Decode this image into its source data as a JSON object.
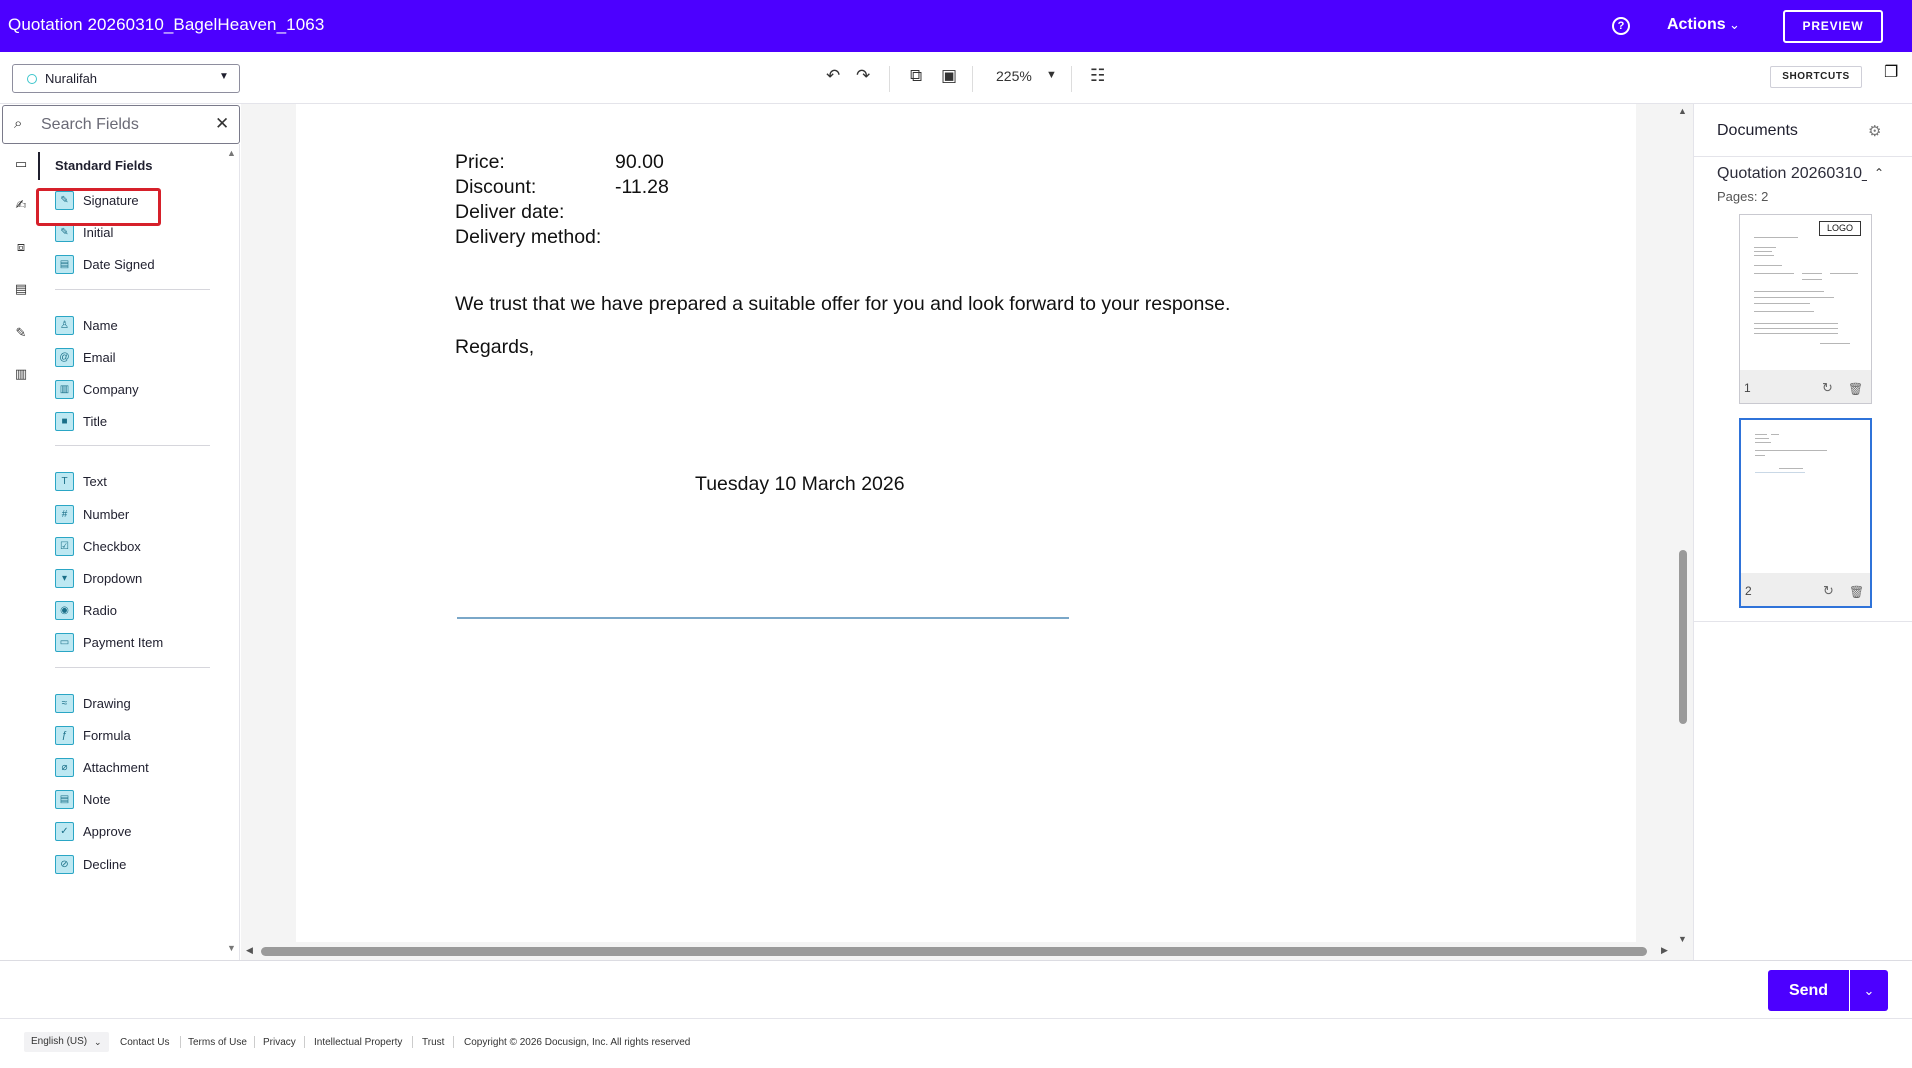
{
  "header": {
    "title": "Quotation 20260310_BagelHeaven_1063",
    "actions_label": "Actions",
    "preview_label": "PREVIEW"
  },
  "toolbar": {
    "recipient": "Nuralifah",
    "zoom": "225%",
    "shortcuts_label": "SHORTCUTS"
  },
  "search": {
    "placeholder": "Search Fields"
  },
  "fields_panel": {
    "heading": "Standard Fields",
    "groups": [
      [
        {
          "label": "Signature",
          "icon": "signature-icon",
          "glyph": "✎"
        },
        {
          "label": "Initial",
          "icon": "initial-icon",
          "glyph": "✎"
        },
        {
          "label": "Date Signed",
          "icon": "date-signed-icon",
          "glyph": "▤"
        }
      ],
      [
        {
          "label": "Name",
          "icon": "name-icon",
          "glyph": "♙"
        },
        {
          "label": "Email",
          "icon": "email-icon",
          "glyph": "@"
        },
        {
          "label": "Company",
          "icon": "company-icon",
          "glyph": "▥"
        },
        {
          "label": "Title",
          "icon": "title-icon",
          "glyph": "■"
        }
      ],
      [
        {
          "label": "Text",
          "icon": "text-icon",
          "glyph": "T"
        },
        {
          "label": "Number",
          "icon": "number-icon",
          "glyph": "#"
        },
        {
          "label": "Checkbox",
          "icon": "checkbox-icon",
          "glyph": "☑"
        },
        {
          "label": "Dropdown",
          "icon": "dropdown-icon",
          "glyph": "▾"
        },
        {
          "label": "Radio",
          "icon": "radio-icon",
          "glyph": "◉"
        },
        {
          "label": "Payment Item",
          "icon": "payment-item-icon",
          "glyph": "▭"
        }
      ],
      [
        {
          "label": "Drawing",
          "icon": "drawing-icon",
          "glyph": "≈"
        },
        {
          "label": "Formula",
          "icon": "formula-icon",
          "glyph": "ƒ"
        },
        {
          "label": "Attachment",
          "icon": "attachment-icon",
          "glyph": "⌀"
        },
        {
          "label": "Note",
          "icon": "note-icon",
          "glyph": "▤"
        },
        {
          "label": "Approve",
          "icon": "approve-icon",
          "glyph": "✓"
        },
        {
          "label": "Decline",
          "icon": "decline-icon",
          "glyph": "⊘"
        }
      ]
    ]
  },
  "document": {
    "price_label": "Price:",
    "price_value": "90.00",
    "discount_label": "Discount:",
    "discount_value": "-11.28",
    "deliver_date_label": "Deliver date:",
    "delivery_method_label": "Delivery method:",
    "closing": "We trust that we have prepared a suitable offer for you and look forward to your response.",
    "regards": "Regards,",
    "date_signed": "Tuesday 10 March 2026"
  },
  "documents_panel": {
    "title": "Documents",
    "doc_name": "Quotation 20260310_BagelHeaven_1063",
    "pages_label": "Pages: 2",
    "thumbnails": [
      {
        "page": "1",
        "logo": "LOGO"
      },
      {
        "page": "2"
      }
    ]
  },
  "bottom": {
    "send_label": "Send"
  },
  "footer": {
    "language": "English (US)",
    "links": [
      "Contact Us",
      "Terms of Use",
      "Privacy",
      "Intellectual Property",
      "Trust"
    ],
    "copyright": "Copyright © 2026 Docusign, Inc. All rights reserved"
  },
  "colors": {
    "brand": "#4c00ff",
    "highlight": "#d6202a",
    "field_icon_bg": "#bde8f2"
  }
}
